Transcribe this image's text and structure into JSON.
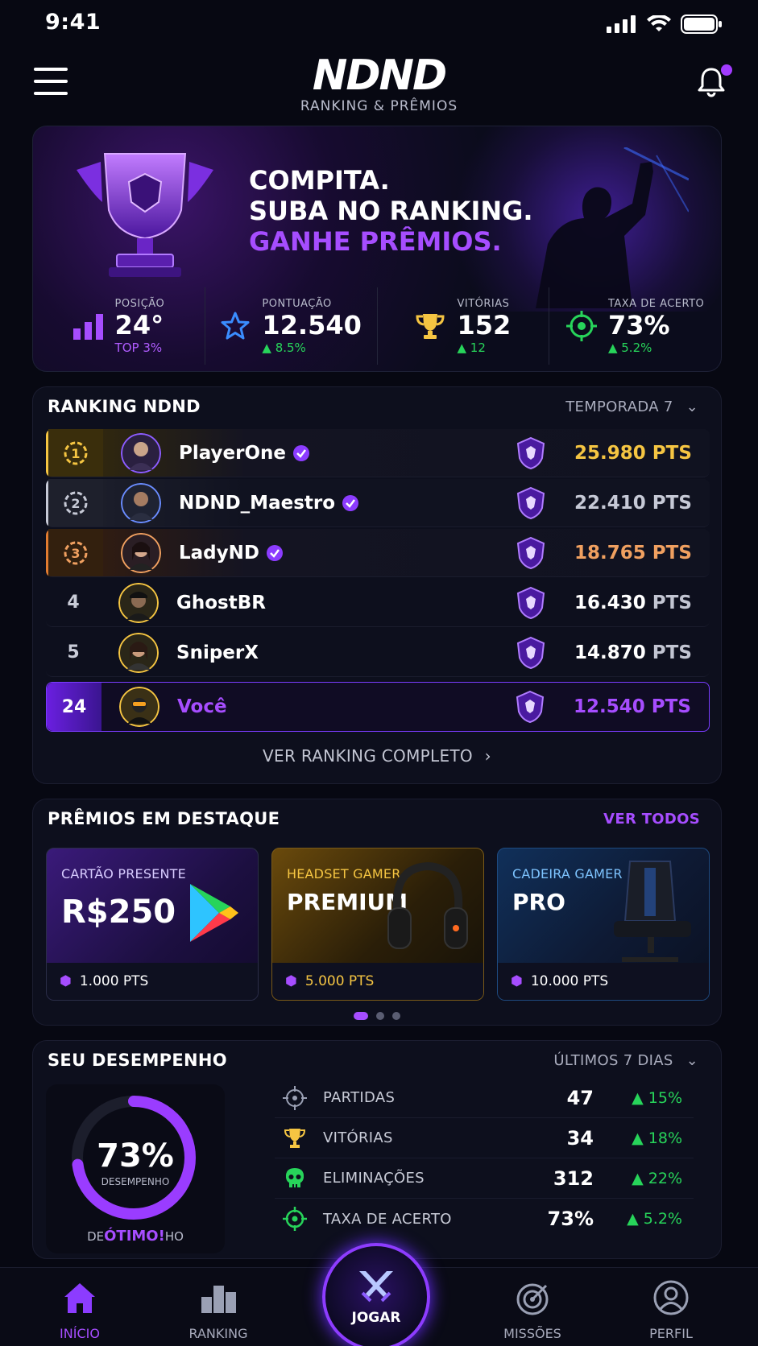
{
  "status": {
    "time": "9:41"
  },
  "header": {
    "logo": "NDND",
    "subtitle": "RANKING & PRÊMIOS"
  },
  "hero": {
    "line1": "COMPITA.",
    "line2": "SUBA NO RANKING.",
    "line3": "GANHE PRÊMIOS.",
    "stats": [
      {
        "label": "POSIÇÃO",
        "value": "24°",
        "sub": "TOP 3%",
        "icon": "bars-icon"
      },
      {
        "label": "PONTUAÇÃO",
        "value": "12.540",
        "sub": "8.5%",
        "icon": "star-icon"
      },
      {
        "label": "VITÓRIAS",
        "value": "152",
        "sub": "12",
        "icon": "trophy-icon"
      },
      {
        "label": "TAXA DE ACERTO",
        "value": "73%",
        "sub": "5.2%",
        "icon": "crosshair-icon"
      }
    ]
  },
  "ranking": {
    "title": "RANKING NDND",
    "season": "TEMPORADA 7",
    "rows": [
      {
        "pos": "1",
        "name": "PlayerOne",
        "pts": "25.980",
        "unit": "PTS",
        "verified": true,
        "color": "#f5c542"
      },
      {
        "pos": "2",
        "name": "NDND_Maestro",
        "pts": "22.410",
        "unit": "PTS",
        "verified": true,
        "color": "#c6c9d6"
      },
      {
        "pos": "3",
        "name": "LadyND",
        "pts": "18.765",
        "unit": "PTS",
        "verified": true,
        "color": "#f0a060"
      },
      {
        "pos": "4",
        "name": "GhostBR",
        "pts": "16.430",
        "unit": "PTS",
        "verified": false,
        "color": "#ffffff"
      },
      {
        "pos": "5",
        "name": "SniperX",
        "pts": "14.870",
        "unit": "PTS",
        "verified": false,
        "color": "#ffffff"
      },
      {
        "pos": "24",
        "name": "Você",
        "pts": "12.540",
        "unit": "PTS",
        "verified": false,
        "color": "#a64dff"
      }
    ],
    "more": "VER RANKING COMPLETO"
  },
  "prizes": {
    "title": "PRÊMIOS EM DESTAQUE",
    "see_all": "VER TODOS",
    "items": [
      {
        "category": "CARTÃO PRESENTE",
        "name": "R$250",
        "pts": "1.000 PTS"
      },
      {
        "category": "HEADSET GAMER",
        "name": "PREMIUM",
        "pts": "5.000 PTS"
      },
      {
        "category": "CADEIRA GAMER",
        "name": "PRO",
        "pts": "10.000 PTS"
      }
    ]
  },
  "performance": {
    "title": "SEU DESEMPENHO",
    "period": "ÚLTIMOS 7 DIAS",
    "donut_value": "73%",
    "donut_fraction": 0.73,
    "donut_label": "DESEMPENHO",
    "donut_caption_pre": "DE",
    "donut_caption": "ÓTIMO!",
    "donut_caption_post": "HO",
    "rows": [
      {
        "label": "PARTIDAS",
        "value": "47",
        "delta": "15%"
      },
      {
        "label": "VITÓRIAS",
        "value": "34",
        "delta": "18%"
      },
      {
        "label": "ELIMINAÇÕES",
        "value": "312",
        "delta": "22%"
      },
      {
        "label": "TAXA DE ACERTO",
        "value": "73%",
        "delta": "5.2%"
      }
    ]
  },
  "nav": {
    "home": "INÍCIO",
    "ranking": "RANKING",
    "play": "JOGAR",
    "missions": "MISSÕES",
    "profile": "PERFIL"
  }
}
